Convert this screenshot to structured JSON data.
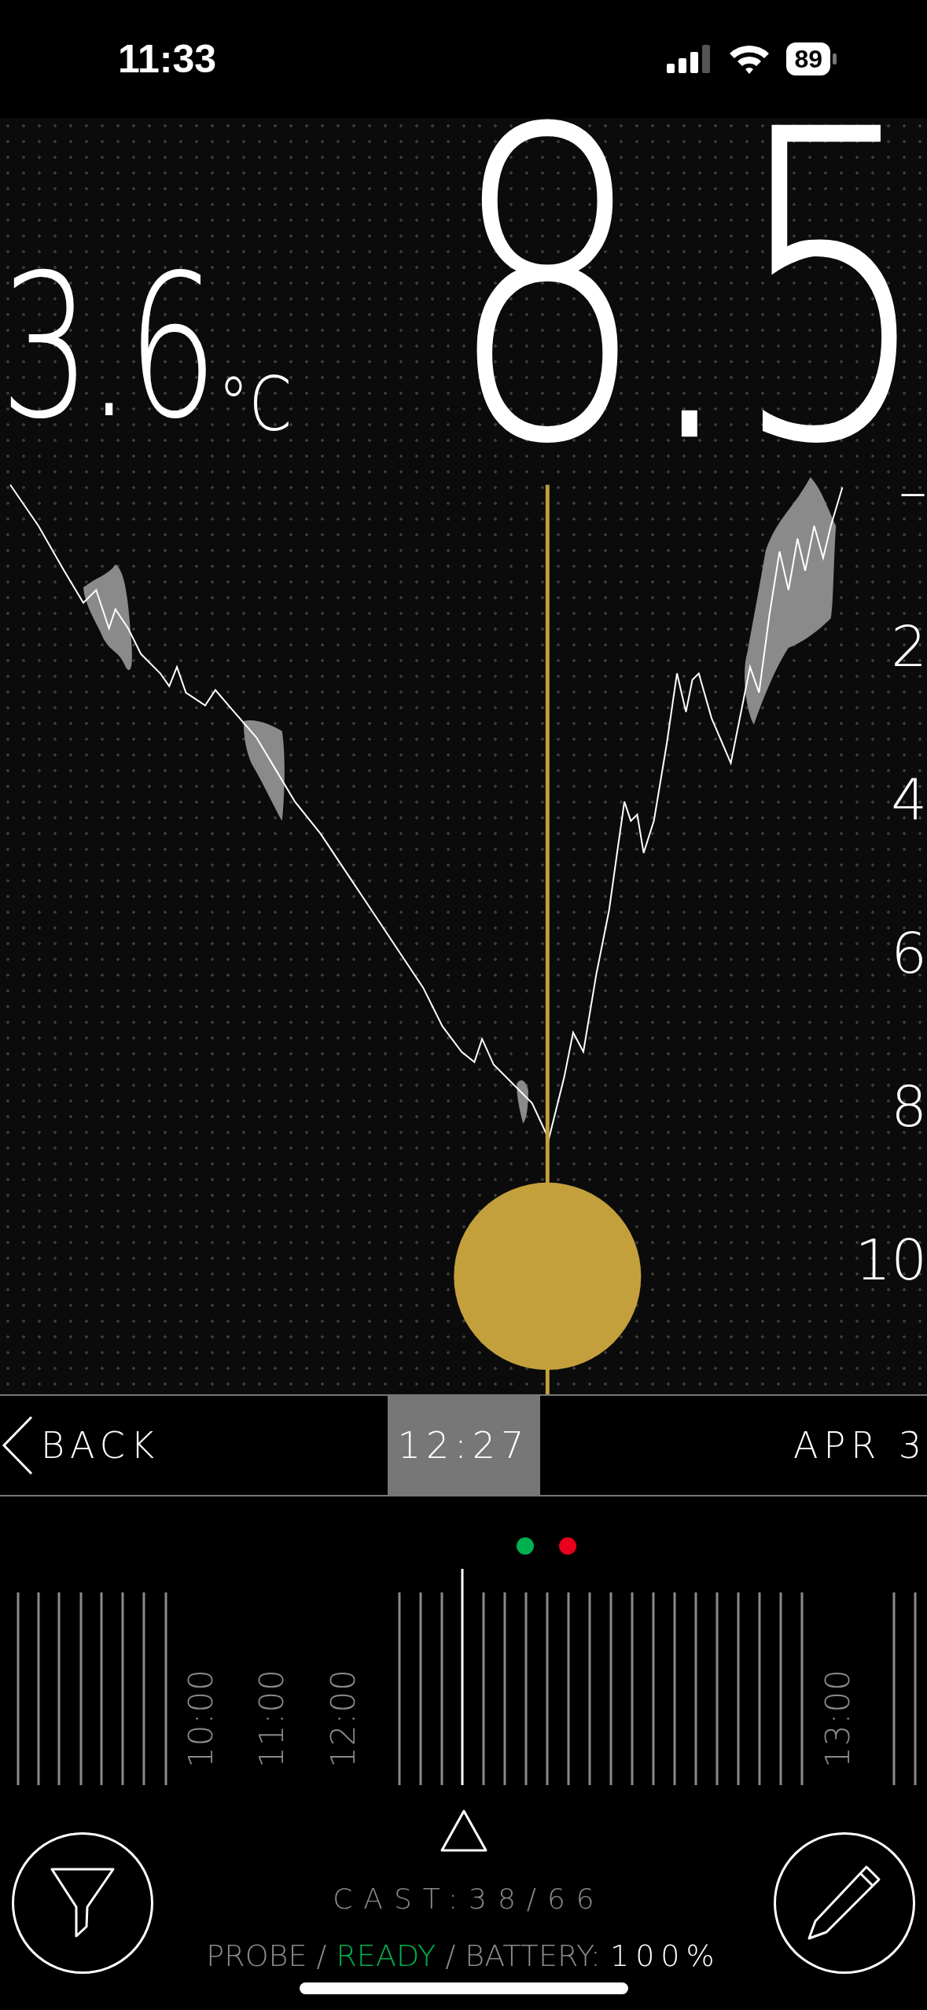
{
  "status_bar": {
    "time": "11:33",
    "battery": "89"
  },
  "readings": {
    "temperature": "3.6",
    "temperature_unit": "°C",
    "depth": "8.5"
  },
  "profile": {
    "depth_ticks": [
      "–",
      "2",
      "4",
      "6",
      "8",
      "10"
    ]
  },
  "nav": {
    "back": "BACK",
    "time": "12:27",
    "date": "APR 3"
  },
  "status_dots": [
    {
      "color": "#00b050"
    },
    {
      "color": "#e8001c"
    }
  ],
  "timeline": {
    "labels": [
      "10:00",
      "11:00",
      "12:00",
      "13:00"
    ]
  },
  "cast": "CAST:38/66",
  "probe": {
    "label": "PROBE /",
    "state": "READY",
    "battery_label": "/ BATTERY:",
    "battery": "100%"
  }
}
